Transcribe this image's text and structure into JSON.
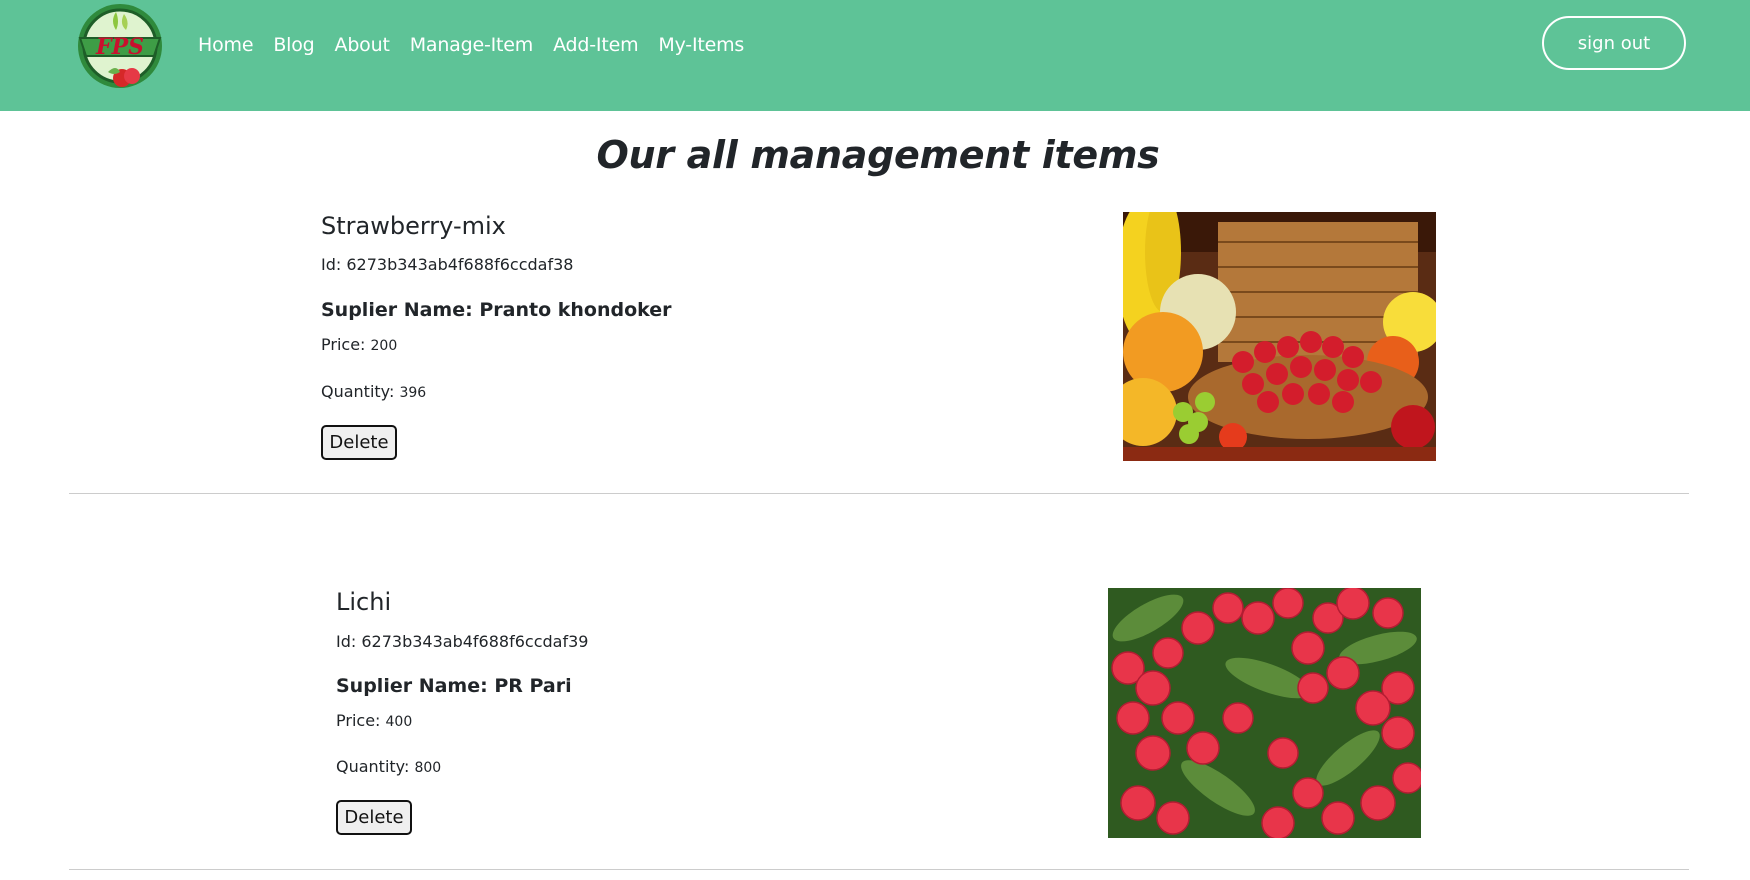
{
  "nav": {
    "brand": "FPS",
    "links": [
      "Home",
      "Blog",
      "About",
      "Manage-Item",
      "Add-Item",
      "My-Items"
    ],
    "signout_label": "sign out",
    "bg_color": "#5ec397"
  },
  "page": {
    "title": "Our all management items"
  },
  "items": [
    {
      "name": "Strawberry-mix",
      "id_label": "Id:",
      "id": "6273b343ab4f688f6ccdaf38",
      "supplier_label": "Suplier Name:",
      "supplier": "Pranto khondoker",
      "price_label": "Price:",
      "price": "200",
      "quantity_label": "Quantity:",
      "quantity": "396",
      "delete_label": "Delete",
      "image": "fruit-basket-with-strawberries"
    },
    {
      "name": "Lichi",
      "id_label": "Id:",
      "id": "6273b343ab4f688f6ccdaf39",
      "supplier_label": "Suplier Name:",
      "supplier": "PR Pari",
      "price_label": "Price:",
      "price": "400",
      "quantity_label": "Quantity:",
      "quantity": "800",
      "delete_label": "Delete",
      "image": "lychee-cluster"
    }
  ]
}
